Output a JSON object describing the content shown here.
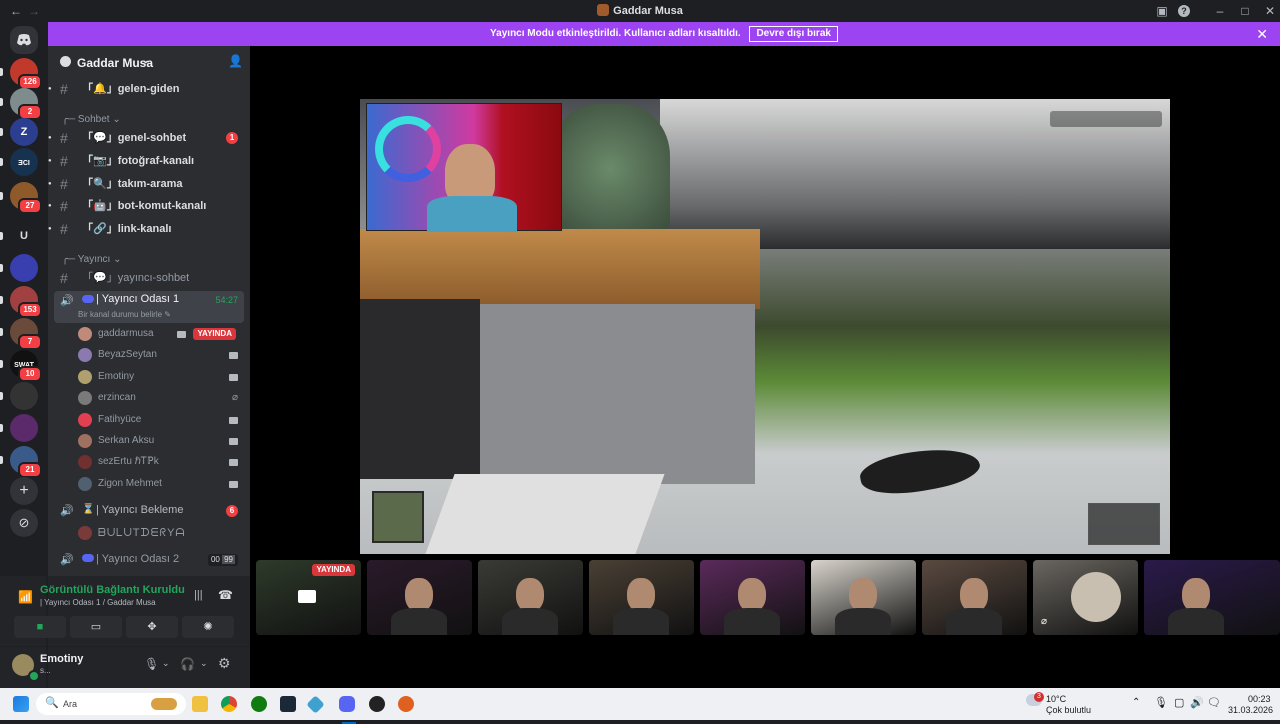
{
  "window": {
    "title": "Gaddar Musa"
  },
  "banner": {
    "text": "Yayıncı Modu etkinleştirildi. Kullanıcı adları kısaltıldı.",
    "button": "Devre dışı bırak"
  },
  "guilds": [
    {
      "label": "",
      "badge": "126",
      "color": "#c0392b"
    },
    {
      "label": "",
      "badge": "2",
      "color": "#7f8c8d"
    },
    {
      "label": "Z",
      "badge": "",
      "color": "#2c3e90"
    },
    {
      "label": "ƎCI",
      "badge": "",
      "color": "#16324f"
    },
    {
      "label": "",
      "badge": "27",
      "color": "#8e5a2a"
    },
    {
      "label": "U",
      "badge": "",
      "color": "#1e1f22"
    },
    {
      "label": "",
      "badge": "",
      "color": "#3a3fb0"
    },
    {
      "label": "",
      "badge": "153",
      "color": "#a04040"
    },
    {
      "label": "",
      "badge": "7",
      "color": "#6a4a3a"
    },
    {
      "label": "SWAT",
      "badge": "10",
      "color": "#111111"
    },
    {
      "label": "",
      "badge": "",
      "color": "#333333"
    },
    {
      "label": "",
      "badge": "",
      "color": "#5a2a6a"
    },
    {
      "label": "",
      "badge": "21",
      "color": "#3a5a8a"
    }
  ],
  "server": {
    "name": "Gaddar Musa"
  },
  "channels": {
    "top": {
      "name": "「🔔」gelen-giden"
    },
    "cat1": "Sohbet",
    "list1": [
      {
        "name": "「💬」genel-sohbet",
        "badge": "1"
      },
      {
        "name": "「📷」fotoğraf-kanalı",
        "badge": ""
      },
      {
        "name": "「🔍」takım-arama",
        "badge": ""
      },
      {
        "name": "「🤖」bot-komut-kanalı",
        "badge": ""
      },
      {
        "name": "「🔗」link-kanalı",
        "badge": ""
      }
    ],
    "cat2": "Yayıncı",
    "yayinci_sohbet": "「💬」yayıncı-sohbet",
    "voice1": {
      "name": "| Yayıncı Odası 1",
      "timer": "54:27",
      "status": "Bir kanal durumu belirle"
    },
    "voice_users": [
      {
        "name": "gaddarmusa",
        "live": "YAYINDA",
        "color": "#c08a7a"
      },
      {
        "name": "BeyazSeytan",
        "live": "",
        "color": "#8a7ab0"
      },
      {
        "name": "Emotiny",
        "live": "",
        "color": "#b0a070"
      },
      {
        "name": "erzincan",
        "live": "",
        "color": "#7a7a7a"
      },
      {
        "name": "Fatihyüce",
        "live": "",
        "color": "#e04050"
      },
      {
        "name": "Serkan Aksu",
        "live": "",
        "color": "#a07060"
      },
      {
        "name": "sezErtu ℏᎢℙk",
        "live": "",
        "color": "#703030"
      },
      {
        "name": "Zigon Mehmet",
        "live": "",
        "color": "#506070"
      }
    ],
    "voice2": {
      "name": "| Yayıncı Bekleme",
      "badge": "6"
    },
    "voice2_user": "ᗷᑌᒪᑌTᗪᗴᖇYᗩ",
    "voice3": {
      "name": "| Yayıncı Odası 2",
      "count1": "00",
      "count2": "99"
    }
  },
  "voice_panel": {
    "status": "Görüntülü Bağlantı Kuruldu",
    "channel": "| Yayıncı Odası 1 / Gaddar Musa"
  },
  "user_panel": {
    "name": "Emotiny",
    "sub": "s..."
  },
  "stream_tiles": [
    {
      "live": "YAYINDA",
      "color": "#2e3a2a"
    },
    {
      "live": "",
      "color": "#2a1a2a"
    },
    {
      "live": "",
      "color": "#3a3a35"
    },
    {
      "live": "",
      "color": "#4a4035"
    },
    {
      "live": "",
      "color": "#5a2a5a"
    },
    {
      "live": "",
      "color": "#d8d4cc"
    },
    {
      "live": "",
      "color": "#5a4a40"
    },
    {
      "live": "",
      "color": "#6a6660"
    },
    {
      "live": "",
      "color": "#2a1a4a"
    }
  ],
  "taskbar": {
    "search": "Ara",
    "weather_temp": "10°C",
    "weather_desc": "Çok bulutlu",
    "time": "00:23",
    "date": "31.03.2026",
    "weather_badge": "3"
  }
}
